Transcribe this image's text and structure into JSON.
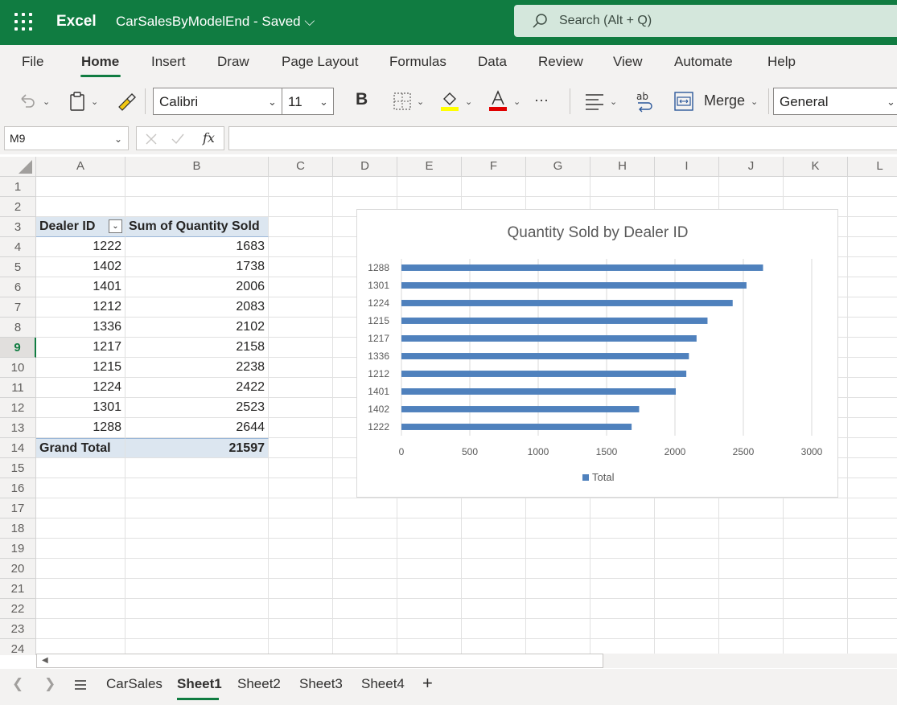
{
  "titlebar": {
    "app_name": "Excel",
    "doc_title": "CarSalesByModelEnd  -  Saved ⌵",
    "search_placeholder": "Search (Alt + Q)"
  },
  "ribbon_tabs": [
    "File",
    "Home",
    "Insert",
    "Draw",
    "Page Layout",
    "Formulas",
    "Data",
    "Review",
    "View",
    "Automate",
    "Help"
  ],
  "toolbar": {
    "font_name": "Calibri",
    "font_size": "11",
    "bold_label": "B",
    "merge_label": "Merge",
    "number_format": "General",
    "more_label": "···"
  },
  "formula_bar": {
    "name_box": "M9",
    "fx_label": "fx",
    "value": ""
  },
  "grid": {
    "columns": [
      "A",
      "B",
      "C",
      "D",
      "E",
      "F",
      "G",
      "H",
      "I",
      "J",
      "K",
      "L"
    ],
    "rows": [
      "1",
      "2",
      "3",
      "4",
      "5",
      "6",
      "7",
      "8",
      "9",
      "10",
      "11",
      "12",
      "13",
      "14",
      "15",
      "16",
      "17",
      "18",
      "19",
      "20",
      "21",
      "22",
      "23",
      "24"
    ],
    "selected_row": "9"
  },
  "pivot": {
    "header_dealer": "Dealer ID",
    "header_sum": "Sum of Quantity Sold",
    "rows": [
      {
        "dealer": "1222",
        "qty": "1683"
      },
      {
        "dealer": "1402",
        "qty": "1738"
      },
      {
        "dealer": "1401",
        "qty": "2006"
      },
      {
        "dealer": "1212",
        "qty": "2083"
      },
      {
        "dealer": "1336",
        "qty": "2102"
      },
      {
        "dealer": "1217",
        "qty": "2158"
      },
      {
        "dealer": "1215",
        "qty": "2238"
      },
      {
        "dealer": "1224",
        "qty": "2422"
      },
      {
        "dealer": "1301",
        "qty": "2523"
      },
      {
        "dealer": "1288",
        "qty": "2644"
      }
    ],
    "total_label": "Grand Total",
    "total_value": "21597"
  },
  "chart_data": {
    "type": "bar",
    "orientation": "horizontal",
    "title": "Quantity Sold by Dealer ID",
    "categories": [
      "1288",
      "1301",
      "1224",
      "1215",
      "1217",
      "1336",
      "1212",
      "1401",
      "1402",
      "1222"
    ],
    "series": [
      {
        "name": "Total",
        "values": [
          2644,
          2523,
          2422,
          2238,
          2158,
          2102,
          2083,
          2006,
          1738,
          1683
        ],
        "color": "#4f81bd"
      }
    ],
    "xlim": [
      0,
      3000
    ],
    "xticks": [
      "0",
      "500",
      "1000",
      "1500",
      "2000",
      "2500",
      "3000"
    ],
    "grid": true,
    "legend_position": "bottom"
  },
  "sheets": [
    "CarSales",
    "Sheet1",
    "Sheet2",
    "Sheet3",
    "Sheet4"
  ],
  "active_sheet": "Sheet1",
  "colors": {
    "brand": "#107c41",
    "pivot_header": "#dce6f0",
    "bar": "#4f81bd"
  }
}
